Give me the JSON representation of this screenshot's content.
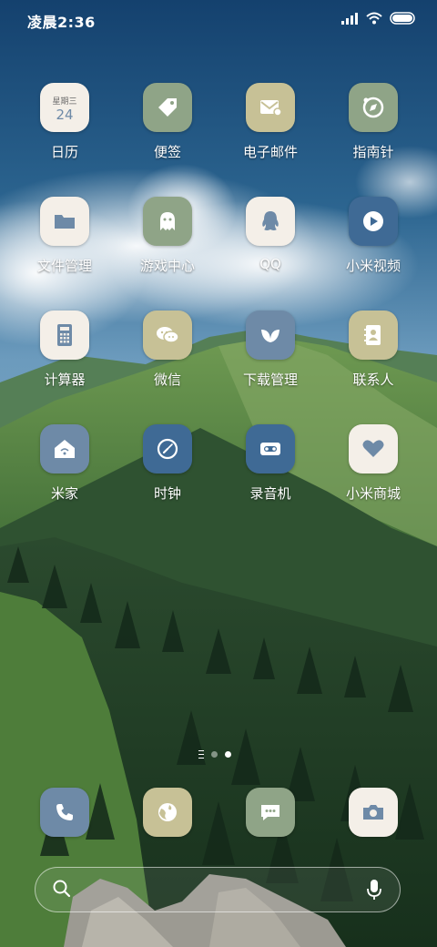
{
  "status_bar": {
    "time": "凌晨2:36",
    "battery_level": 1.0
  },
  "apps": [
    {
      "id": "calendar",
      "label": "日历",
      "icon": "calendar-icon",
      "weekday": "星期三",
      "date": "24"
    },
    {
      "id": "notes",
      "label": "便签",
      "icon": "tag-icon"
    },
    {
      "id": "email",
      "label": "电子邮件",
      "icon": "mail-icon"
    },
    {
      "id": "compass",
      "label": "指南针",
      "icon": "compass-icon"
    },
    {
      "id": "file-manager",
      "label": "文件管理",
      "icon": "folder-icon"
    },
    {
      "id": "game-center",
      "label": "游戏中心",
      "icon": "ghost-icon"
    },
    {
      "id": "qq",
      "label": "QQ",
      "icon": "qq-penguin-icon"
    },
    {
      "id": "mi-video",
      "label": "小米视频",
      "icon": "play-icon"
    },
    {
      "id": "calculator",
      "label": "计算器",
      "icon": "calculator-icon"
    },
    {
      "id": "wechat",
      "label": "微信",
      "icon": "wechat-icon"
    },
    {
      "id": "downloads",
      "label": "下载管理",
      "icon": "leaf-icon"
    },
    {
      "id": "contacts",
      "label": "联系人",
      "icon": "contacts-icon"
    },
    {
      "id": "mi-home",
      "label": "米家",
      "icon": "smart-home-icon"
    },
    {
      "id": "clock",
      "label": "时钟",
      "icon": "clock-icon"
    },
    {
      "id": "recorder",
      "label": "录音机",
      "icon": "cassette-icon"
    },
    {
      "id": "mi-store",
      "label": "小米商城",
      "icon": "heart-icon"
    }
  ],
  "dock": [
    {
      "id": "phone",
      "icon": "phone-icon"
    },
    {
      "id": "browser",
      "icon": "globe-icon"
    },
    {
      "id": "messages",
      "icon": "message-icon"
    },
    {
      "id": "camera",
      "icon": "camera-icon"
    }
  ],
  "page_indicator": {
    "pages": 2,
    "current": 2
  },
  "colors": {
    "tile_white": "#f4efe8",
    "tile_sage": "#8fa487",
    "tile_khaki": "#c7c196",
    "tile_blue": "#3f6a95",
    "tile_slate": "#6e8aa7"
  }
}
